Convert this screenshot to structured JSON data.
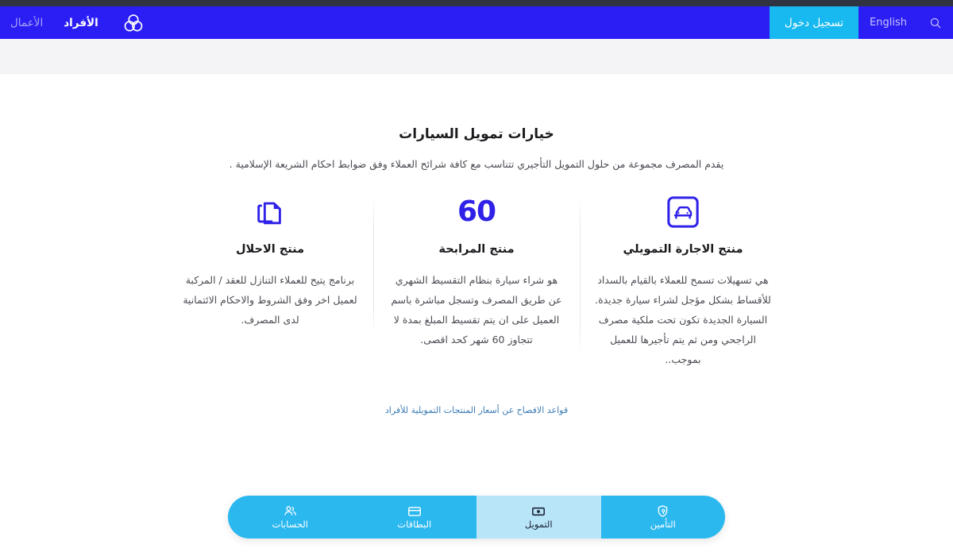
{
  "theme": {
    "nav_blue": "#2a1ef5",
    "login_cyan": "#17b9f0",
    "icon_indigo": "#2f21e8",
    "bottom_nav_cyan": "#2bb8ef",
    "bottom_nav_active": "#b9e5f9",
    "link_blue": "#3d7cb5",
    "top_strip": "#2f3440",
    "subband_grey": "#f4f4f6"
  },
  "header": {
    "logo_name": "alrajhi-bank-logo",
    "segments": [
      {
        "label": "الأفراد",
        "active": true,
        "name": "nav-segment-individuals"
      },
      {
        "label": "الأعمال",
        "active": false,
        "name": "nav-segment-business"
      }
    ],
    "search_icon": "search-icon",
    "language_label": "English",
    "login_label": "تسجيل دخول"
  },
  "main": {
    "title": "خيارات تمويل السيارات",
    "subtitle": "يقدم المصرف مجموعة من حلول التمويل التأجيري تتناسب مع كافة شرائح العملاء وفق ضوابط احكام الشريعة الإسلامية .",
    "products": [
      {
        "icon": "car-in-frame-icon",
        "icon_text": "",
        "title": "منتج الاجارة التمويلي",
        "description": "هي تسهيلات تسمح للعملاء بالقيام بالسداد للأقساط بشكل مؤجل لشراء سيارة جديدة. السيارة الجديدة تكون تحت ملكية مصرف الراجحي ومن ثم يتم تأجيرها للعميل بموجب.."
      },
      {
        "icon": "number-60-icon",
        "icon_text": "60",
        "title": "منتج المرابحة",
        "description": "هو شراء سيارة بنظام التقسيط الشهري عن طريق المصرف وتسجل مباشرة باسم العميل على ان يتم تقسيط المبلغ بمدة لا تتجاوز 60 شهر كحد اقصى."
      },
      {
        "icon": "copy-documents-icon",
        "icon_text": "",
        "title": "منتج الاحلال",
        "description": "برنامج يتيح للعملاء التنازل للعقد / المركبة لعميل اخر وفق الشروط والاحكام الائتمانية لدى المصرف."
      }
    ],
    "disclosure_link": "قواعد الافصاح عن أسعار المنتجات التمويلية للأفراد"
  },
  "bottom_nav": {
    "items": [
      {
        "label": "الحسابات",
        "icon": "people-accounts-icon",
        "active": false,
        "name": "bottom-nav-accounts"
      },
      {
        "label": "البطاقات",
        "icon": "credit-card-icon",
        "active": false,
        "name": "bottom-nav-cards"
      },
      {
        "label": "التمويل",
        "icon": "banknote-icon",
        "active": true,
        "name": "bottom-nav-financing"
      },
      {
        "label": "التأمين",
        "icon": "shield-lock-icon",
        "active": false,
        "name": "bottom-nav-insurance"
      }
    ]
  }
}
